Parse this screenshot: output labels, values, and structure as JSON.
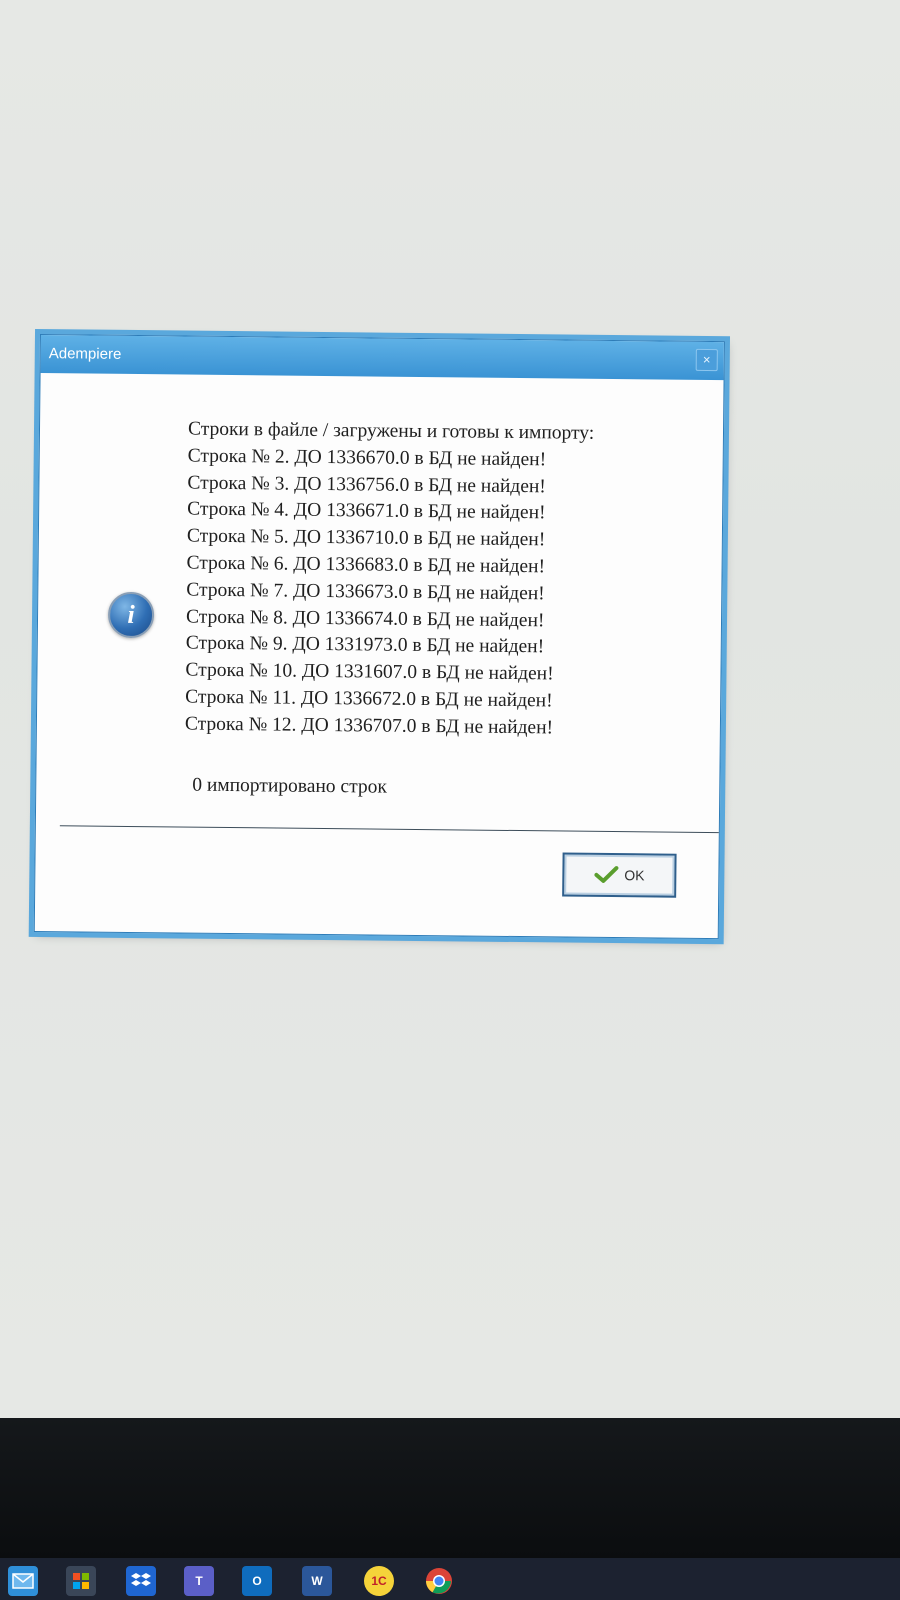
{
  "dialog": {
    "title": "Adempiere",
    "close_glyph": "×",
    "icon": "info-icon",
    "header": "Строки в файле / загружены и готовы к импорту:",
    "rows": [
      "Строка № 2. ДО 1336670.0 в БД не найден!",
      "Строка № 3. ДО 1336756.0 в БД не найден!",
      "Строка № 4. ДО 1336671.0 в БД не найден!",
      "Строка № 5. ДО 1336710.0 в БД не найден!",
      "Строка № 6. ДО 1336683.0 в БД не найден!",
      "Строка № 7. ДО 1336673.0 в БД не найден!",
      "Строка № 8. ДО 1336674.0 в БД не найден!",
      "Строка № 9. ДО 1331973.0 в БД не найден!",
      "Строка № 10. ДО 1331607.0 в БД не найден!",
      "Строка № 11. ДО 1336672.0 в БД не найден!",
      "Строка № 12. ДО 1336707.0 в БД не найден!"
    ],
    "summary": "0 импортировано строк",
    "ok_label": "OK"
  },
  "taskbar": {
    "icons": [
      "mail-icon",
      "store-icon",
      "dropbox-icon",
      "teams-icon",
      "outlook-icon",
      "word-icon",
      "1c-icon",
      "chrome-icon"
    ],
    "labels": {
      "teams": "T",
      "outlook": "O",
      "word": "W",
      "onec": "1C"
    }
  },
  "colors": {
    "titlebar": "#3a93d4",
    "frame": "#5aa8dc",
    "check": "#5a9e2e"
  }
}
